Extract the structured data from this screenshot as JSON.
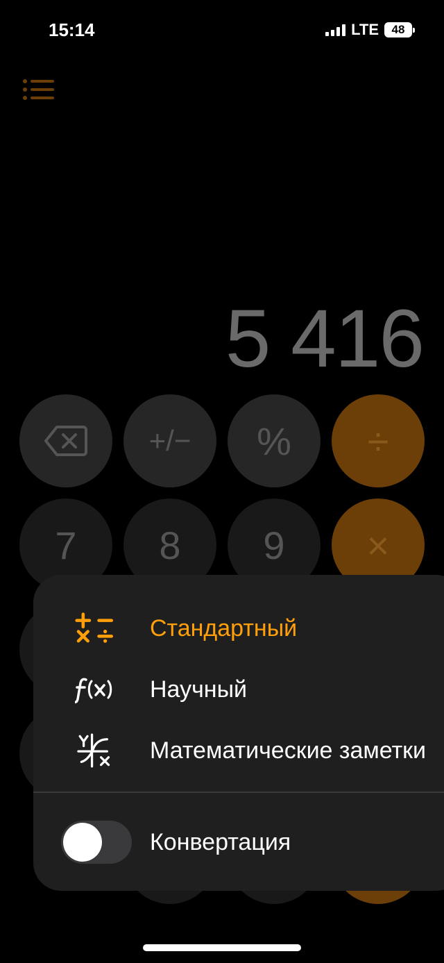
{
  "status_bar": {
    "time": "15:14",
    "network": "LTE",
    "battery": "48"
  },
  "display": {
    "value": "5 416"
  },
  "keypad": {
    "row1": [
      "⌫",
      "+/−",
      "%",
      "÷"
    ],
    "row2": [
      "7",
      "8",
      "9",
      "×"
    ]
  },
  "menu": {
    "items": [
      {
        "label": "Стандартный",
        "icon": "standard-calculator-icon",
        "active": true
      },
      {
        "label": "Научный",
        "icon": "fx-icon",
        "active": false
      },
      {
        "label": "Математические заметки",
        "icon": "math-notes-icon",
        "active": false
      }
    ],
    "toggle": {
      "label": "Конвертация",
      "on": false
    }
  },
  "colors": {
    "accent": "#FF9F0A",
    "background": "#000000",
    "panel": "#1F1F1F"
  }
}
